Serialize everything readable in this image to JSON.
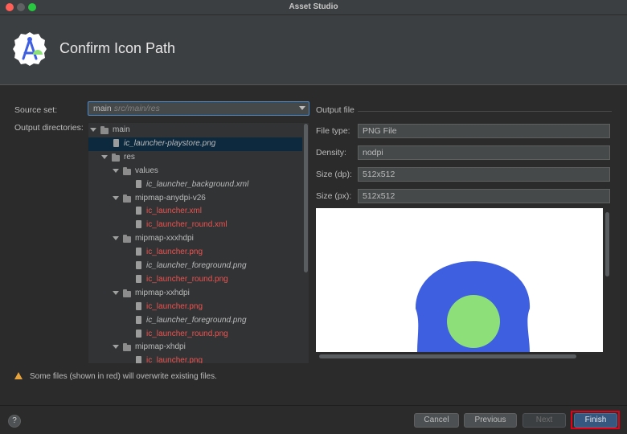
{
  "window": {
    "title": "Asset Studio"
  },
  "header": {
    "title": "Confirm Icon Path"
  },
  "labels": {
    "source_set": "Source set:",
    "output_dirs": "Output directories:"
  },
  "source_set": {
    "value": "main",
    "hint": "src/main/res"
  },
  "tree": [
    {
      "label": "main",
      "type": "folder",
      "depth": 0,
      "expanded": true
    },
    {
      "label": "ic_launcher-playstore.png",
      "type": "file",
      "depth": 1,
      "style": "italic",
      "selected": true
    },
    {
      "label": "res",
      "type": "folder",
      "depth": 1,
      "expanded": true
    },
    {
      "label": "values",
      "type": "folder",
      "depth": 2,
      "expanded": true
    },
    {
      "label": "ic_launcher_background.xml",
      "type": "file",
      "depth": 3,
      "style": "italic"
    },
    {
      "label": "mipmap-anydpi-v26",
      "type": "folder",
      "depth": 2,
      "expanded": true
    },
    {
      "label": "ic_launcher.xml",
      "type": "file",
      "depth": 3,
      "style": "red"
    },
    {
      "label": "ic_launcher_round.xml",
      "type": "file",
      "depth": 3,
      "style": "red"
    },
    {
      "label": "mipmap-xxxhdpi",
      "type": "folder",
      "depth": 2,
      "expanded": true
    },
    {
      "label": "ic_launcher.png",
      "type": "file",
      "depth": 3,
      "style": "red"
    },
    {
      "label": "ic_launcher_foreground.png",
      "type": "file",
      "depth": 3,
      "style": "italic"
    },
    {
      "label": "ic_launcher_round.png",
      "type": "file",
      "depth": 3,
      "style": "red"
    },
    {
      "label": "mipmap-xxhdpi",
      "type": "folder",
      "depth": 2,
      "expanded": true
    },
    {
      "label": "ic_launcher.png",
      "type": "file",
      "depth": 3,
      "style": "red"
    },
    {
      "label": "ic_launcher_foreground.png",
      "type": "file",
      "depth": 3,
      "style": "italic"
    },
    {
      "label": "ic_launcher_round.png",
      "type": "file",
      "depth": 3,
      "style": "red"
    },
    {
      "label": "mipmap-xhdpi",
      "type": "folder",
      "depth": 2,
      "expanded": true
    },
    {
      "label": "ic_launcher.png",
      "type": "file",
      "depth": 3,
      "style": "red"
    }
  ],
  "output_file": {
    "header": "Output file",
    "file_type_label": "File type:",
    "file_type": "PNG File",
    "density_label": "Density:",
    "density": "nodpi",
    "size_dp_label": "Size (dp):",
    "size_dp": "512x512",
    "size_px_label": "Size (px):",
    "size_px": "512x512"
  },
  "preview": {
    "outer_color": "#3e5fe0",
    "inner_color": "#8ddf7a"
  },
  "warning": "Some files (shown in red) will overwrite existing files.",
  "buttons": {
    "help": "?",
    "cancel": "Cancel",
    "previous": "Previous",
    "next": "Next",
    "finish": "Finish"
  },
  "colors": {
    "red_text": "#ef5350",
    "selection": "#0d293e",
    "accent": "#4a88c7"
  }
}
